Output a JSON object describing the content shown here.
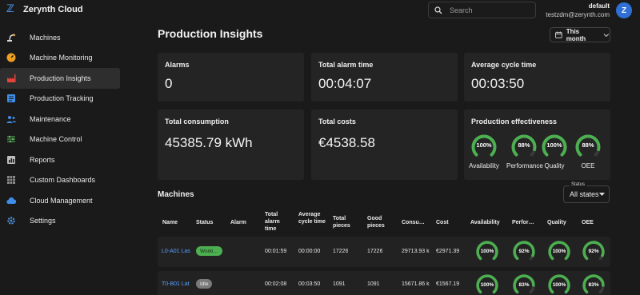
{
  "app": {
    "title": "Zerynth Cloud"
  },
  "search": {
    "placeholder": "Search"
  },
  "user": {
    "name": "default",
    "email": "testzdm@zerynth.com",
    "initial": "Z"
  },
  "colors": {
    "accent": "#2f6fd6",
    "gauge_green": "#4caf50",
    "link": "#5aa0ff"
  },
  "sidebar": {
    "items": [
      {
        "label": "Machines",
        "icon": "machine-arm-icon",
        "active": false
      },
      {
        "label": "Machine Monitoring",
        "icon": "monitor-gauge-icon",
        "active": false
      },
      {
        "label": "Production Insights",
        "icon": "factory-icon",
        "active": true
      },
      {
        "label": "Production Tracking",
        "icon": "tracking-list-icon",
        "active": false
      },
      {
        "label": "Maintenance",
        "icon": "maintenance-people-icon",
        "active": false
      },
      {
        "label": "Machine Control",
        "icon": "control-sliders-icon",
        "active": false
      },
      {
        "label": "Reports",
        "icon": "reports-chart-icon",
        "active": false
      },
      {
        "label": "Custom Dashboards",
        "icon": "dashboard-grid-icon",
        "active": false
      },
      {
        "label": "Cloud Management",
        "icon": "cloud-icon",
        "active": false
      },
      {
        "label": "Settings",
        "icon": "gear-icon",
        "active": false
      }
    ]
  },
  "page": {
    "title": "Production Insights",
    "period": "This month"
  },
  "cards": {
    "alarms": {
      "label": "Alarms",
      "value": "0"
    },
    "total_alarm_time": {
      "label": "Total alarm time",
      "value": "00:04:07"
    },
    "avg_cycle_time": {
      "label": "Average cycle time",
      "value": "00:03:50"
    },
    "total_consumption": {
      "label": "Total consumption",
      "value": "45385.79 kWh"
    },
    "total_costs": {
      "label": "Total costs",
      "value": "€4538.58"
    },
    "effectiveness": {
      "label": "Production effectiveness",
      "gauges": [
        {
          "label": "Availability",
          "text": "100%",
          "value": 1.0
        },
        {
          "label": "Performance",
          "text": "88%",
          "value": 0.88
        },
        {
          "label": "Quality",
          "text": "100%",
          "value": 1.0
        },
        {
          "label": "OEE",
          "text": "88%",
          "value": 0.88
        }
      ]
    }
  },
  "machines": {
    "title": "Machines",
    "status_filter": {
      "label": "Status",
      "value": "All states"
    },
    "columns": {
      "name": "Name",
      "status": "Status",
      "alarm": "Alarm",
      "total_alarm_time": "Total alarm time",
      "avg_cycle_time": "Average cycle time",
      "total_pieces": "Total pieces",
      "good_pieces": "Good pieces",
      "consumption": "Consu…",
      "cost": "Cost",
      "availability": "Availability",
      "performance": "Perfor…",
      "quality": "Quality",
      "oee": "OEE"
    },
    "rows": [
      {
        "name": "L0-A01 Las",
        "status": "Worki…",
        "status_kind": "work",
        "alarm": "",
        "total_alarm_time": "00:01:59",
        "avg_cycle_time": "00:00:00",
        "total_pieces": "17226",
        "good_pieces": "17226",
        "consumption": "29713.93 k",
        "cost": "€2971.39",
        "gauges": [
          {
            "text": "100%",
            "value": 1.0
          },
          {
            "text": "92%",
            "value": 0.92
          },
          {
            "text": "100%",
            "value": 1.0
          },
          {
            "text": "92%",
            "value": 0.92
          }
        ]
      },
      {
        "name": "T0-B01 Lat",
        "status": "Idle",
        "status_kind": "idle",
        "alarm": "",
        "total_alarm_time": "00:02:08",
        "avg_cycle_time": "00:03:50",
        "total_pieces": "1091",
        "good_pieces": "1091",
        "consumption": "15671.86 k",
        "cost": "€1567.19",
        "gauges": [
          {
            "text": "100%",
            "value": 1.0
          },
          {
            "text": "83%",
            "value": 0.83
          },
          {
            "text": "100%",
            "value": 1.0
          },
          {
            "text": "83%",
            "value": 0.83
          }
        ]
      }
    ]
  }
}
